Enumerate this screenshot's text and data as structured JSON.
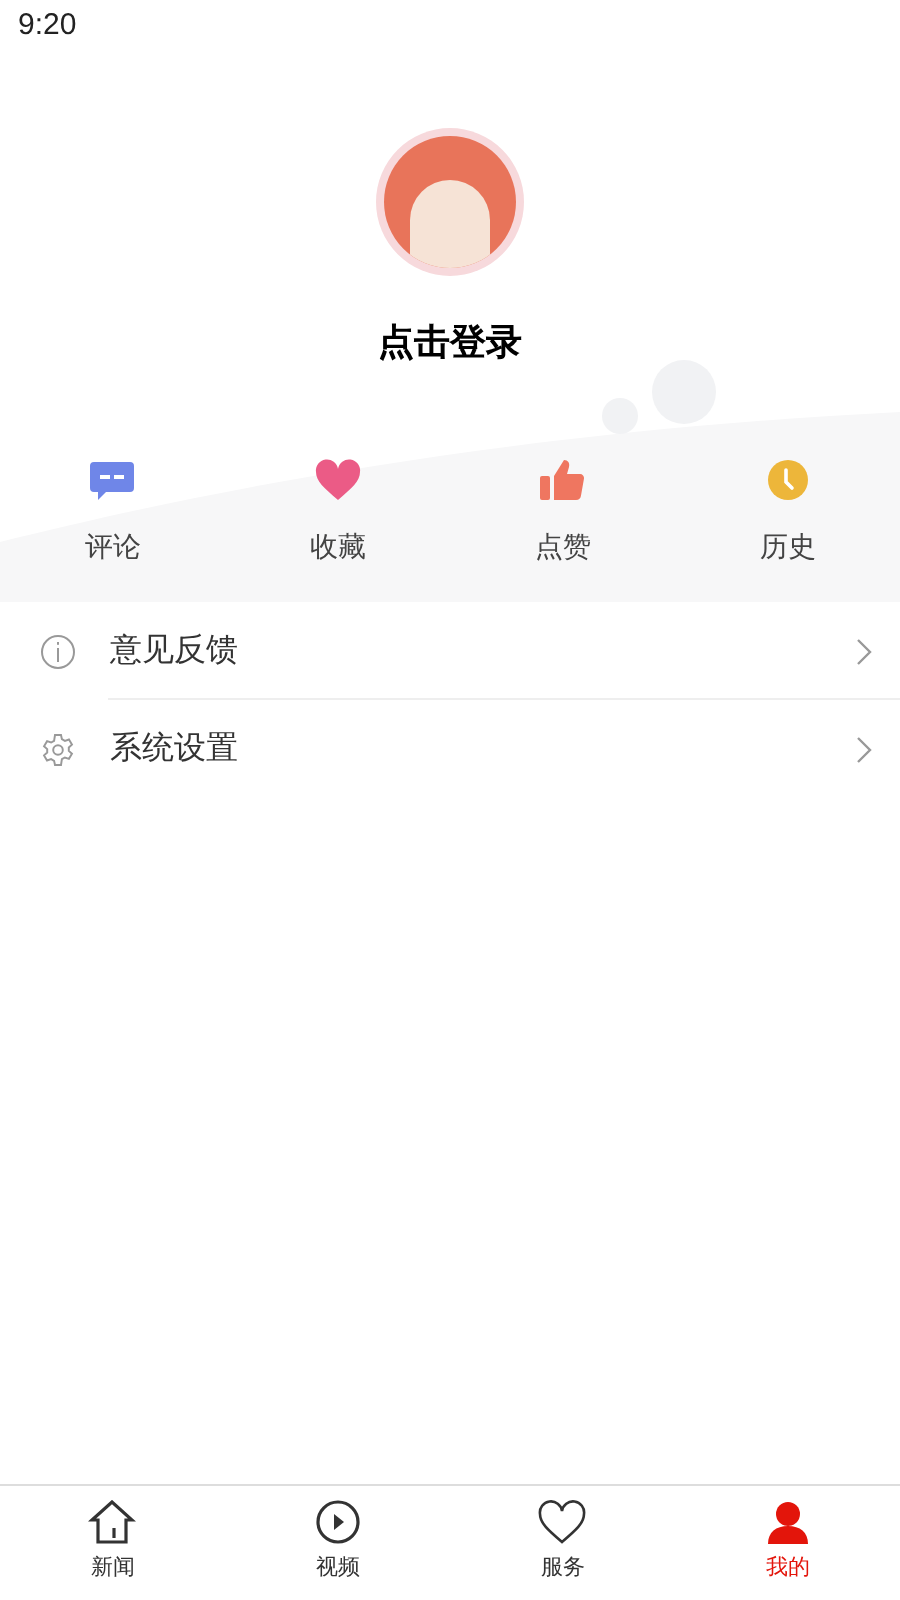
{
  "status_bar": {
    "time": "9:20"
  },
  "profile": {
    "login_label": "点击登录"
  },
  "quick_actions": [
    {
      "kind": "comment",
      "label": "评论"
    },
    {
      "kind": "favorite",
      "label": "收藏"
    },
    {
      "kind": "like",
      "label": "点赞"
    },
    {
      "kind": "history",
      "label": "历史"
    }
  ],
  "menu": [
    {
      "kind": "info",
      "label": "意见反馈"
    },
    {
      "kind": "settings",
      "label": "系统设置"
    }
  ],
  "tabs": [
    {
      "kind": "home",
      "label": "新闻",
      "selected": false
    },
    {
      "kind": "video",
      "label": "视频",
      "selected": false
    },
    {
      "kind": "service",
      "label": "服务",
      "selected": false
    },
    {
      "kind": "me",
      "label": "我的",
      "selected": true
    }
  ]
}
